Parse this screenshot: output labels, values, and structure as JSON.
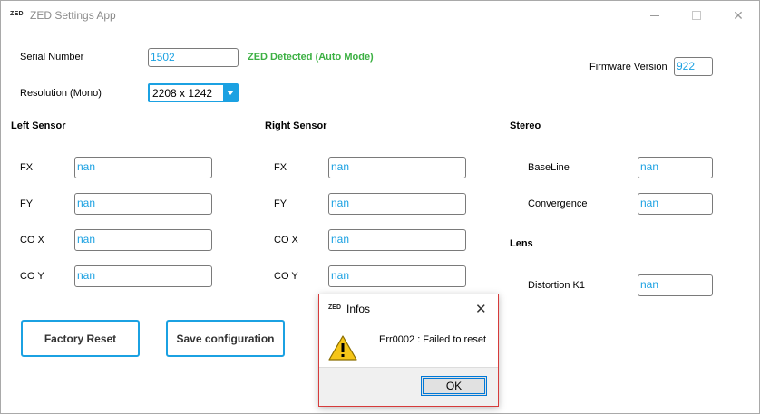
{
  "window": {
    "logo": "ZED",
    "title": "ZED Settings App"
  },
  "header": {
    "serial_label": "Serial Number",
    "serial_value": "1502",
    "status": "ZED Detected (Auto Mode)",
    "firmware_label": "Firmware Version",
    "firmware_value": "922",
    "resolution_label": "Resolution (Mono)",
    "resolution_value": "2208 x 1242"
  },
  "left_sensor": {
    "title": "Left Sensor",
    "fields": [
      {
        "label": "FX",
        "value": "nan"
      },
      {
        "label": "FY",
        "value": "nan"
      },
      {
        "label": "CO X",
        "value": "nan"
      },
      {
        "label": "CO Y",
        "value": "nan"
      }
    ]
  },
  "right_sensor": {
    "title": "Right Sensor",
    "fields": [
      {
        "label": "FX",
        "value": "nan"
      },
      {
        "label": "FY",
        "value": "nan"
      },
      {
        "label": "CO X",
        "value": "nan"
      },
      {
        "label": "CO Y",
        "value": "nan"
      }
    ]
  },
  "stereo": {
    "title": "Stereo",
    "fields": [
      {
        "label": "BaseLine",
        "value": "nan"
      },
      {
        "label": "Convergence",
        "value": "nan"
      }
    ]
  },
  "lens": {
    "title": "Lens",
    "fields": [
      {
        "label": "Distortion K1",
        "value": "nan"
      }
    ]
  },
  "buttons": {
    "factory_reset": "Factory Reset",
    "save_configuration": "Save configuration"
  },
  "dialog": {
    "logo": "ZED",
    "title": "Infos",
    "close": "✕",
    "message": "Err0002 : Failed to reset",
    "ok": "OK",
    "icon": "warning-icon"
  },
  "colors": {
    "accent": "#1ba1e2",
    "status_green": "#3cb043",
    "dialog_border": "#d63b3b"
  }
}
